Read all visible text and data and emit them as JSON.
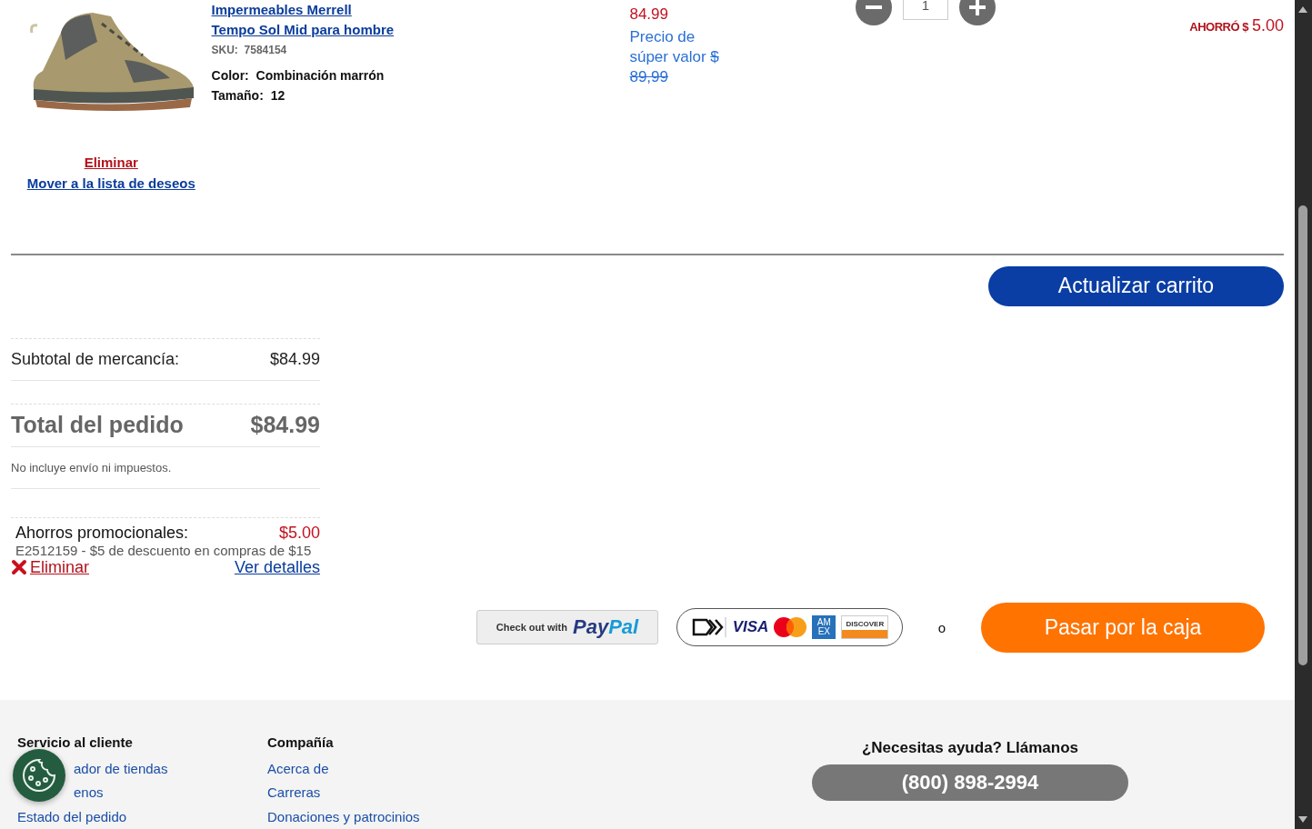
{
  "product": {
    "title_lines": [
      "Impermeables Merrell",
      "Tempo Sol Mid para hombre"
    ],
    "image": {
      "kind": "picture"
    },
    "sku_label": "SKU:",
    "sku": "7584154",
    "attributes": [
      {
        "label": "Color:",
        "value": "Combinación marrón"
      },
      {
        "label": "Tamaño:",
        "value": "12"
      }
    ],
    "remove_link": "Eliminar",
    "wishlist_link": "Mover a la lista de deseos",
    "price": "84.99",
    "was_price_label": "Precio de súper valor",
    "was_price": "$ 89,99",
    "quantity": "1",
    "savings_label": "AHORRÓ $",
    "savings": "5.00"
  },
  "update_button": "Actualizar carrito",
  "summary": {
    "subtotal_label": "Subtotal de mercancía:",
    "subtotal": "$84.99",
    "total_label": "Total del pedido",
    "total": "$84.99",
    "note": "No incluye envío ni impuestos.",
    "promo": {
      "label": "Ahorros promocionales:",
      "amount": "$5.00",
      "description": "E2512159 - $5 de descuento en compras de $15",
      "remove_link": "Eliminar",
      "details_link": "Ver detalles"
    }
  },
  "payment": {
    "paypal_prefix": "Check out with",
    "paypal_brand": [
      "Pay",
      "Pal"
    ],
    "cards": [
      {
        "kind": "link"
      },
      {
        "kind": "visa",
        "label": "VISA"
      },
      {
        "kind": "mastercard"
      },
      {
        "kind": "amex",
        "label": "AM EX"
      },
      {
        "kind": "discover",
        "label": "DISCOVER"
      }
    ],
    "separator": "o",
    "checkout_button": "Pasar por la caja"
  },
  "footer": {
    "columns": [
      {
        "heading": "Servicio al cliente",
        "links": [
          "ador de tiendas",
          "enos",
          "Estado del pedido"
        ]
      },
      {
        "heading": "Compañía",
        "links": [
          "Acerca de",
          "Carreras",
          "Donaciones y patrocinios"
        ]
      }
    ],
    "help": {
      "heading": "¿Necesitas ayuda? Llámanos",
      "phone": "(800) 898-2994"
    }
  }
}
